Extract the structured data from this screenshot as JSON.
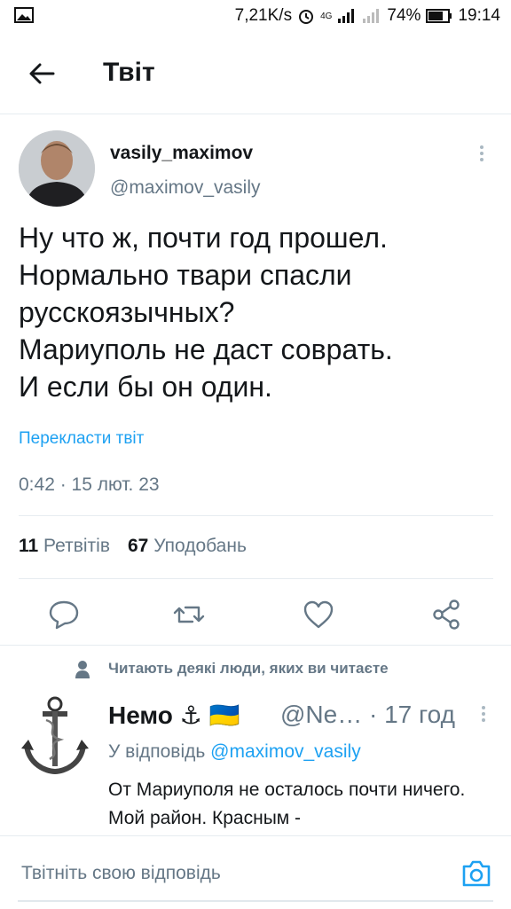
{
  "status_bar": {
    "network_speed": "7,21K/s",
    "network_type": "4G",
    "battery": "74%",
    "time": "19:14",
    "icons": [
      "gallery-icon",
      "alarm-icon",
      "signal-icon",
      "signal-icon-2",
      "battery-icon"
    ]
  },
  "header": {
    "title": "Твіт"
  },
  "tweet": {
    "display_name": "vasily_maximov",
    "handle": "@maximov_vasily",
    "lines": [
      "Ну что ж, почти год прошел.",
      "Нормально твари спасли",
      "русскоязычных?",
      "Мариуполь не даст соврать.",
      "И если бы он один."
    ],
    "translate_label": "Перекласти твіт",
    "timestamp": "0:42 · 15 лют. 23",
    "retweet_count": "11",
    "retweet_label": "Ретвітів",
    "like_count": "67",
    "like_label": "Уподобань",
    "actions": [
      "reply-icon",
      "retweet-icon",
      "like-icon",
      "share-icon"
    ]
  },
  "social_context": "Читають деякі люди, яких ви читаєте",
  "reply": {
    "display_name": "Немо ⚓ 🇺🇦",
    "handle_time": "@Ne… · 17 год",
    "replying_to_label": "У відповідь",
    "replying_to_handle": "@maximov_vasily",
    "text": "От Мариуполя не осталось почти ничего. Мой район. Красным -"
  },
  "composer": {
    "placeholder": "Твітніть свою відповідь"
  },
  "colors": {
    "accent": "#1da1f2",
    "secondary_text": "#657786",
    "divider": "#e6ecf0"
  }
}
